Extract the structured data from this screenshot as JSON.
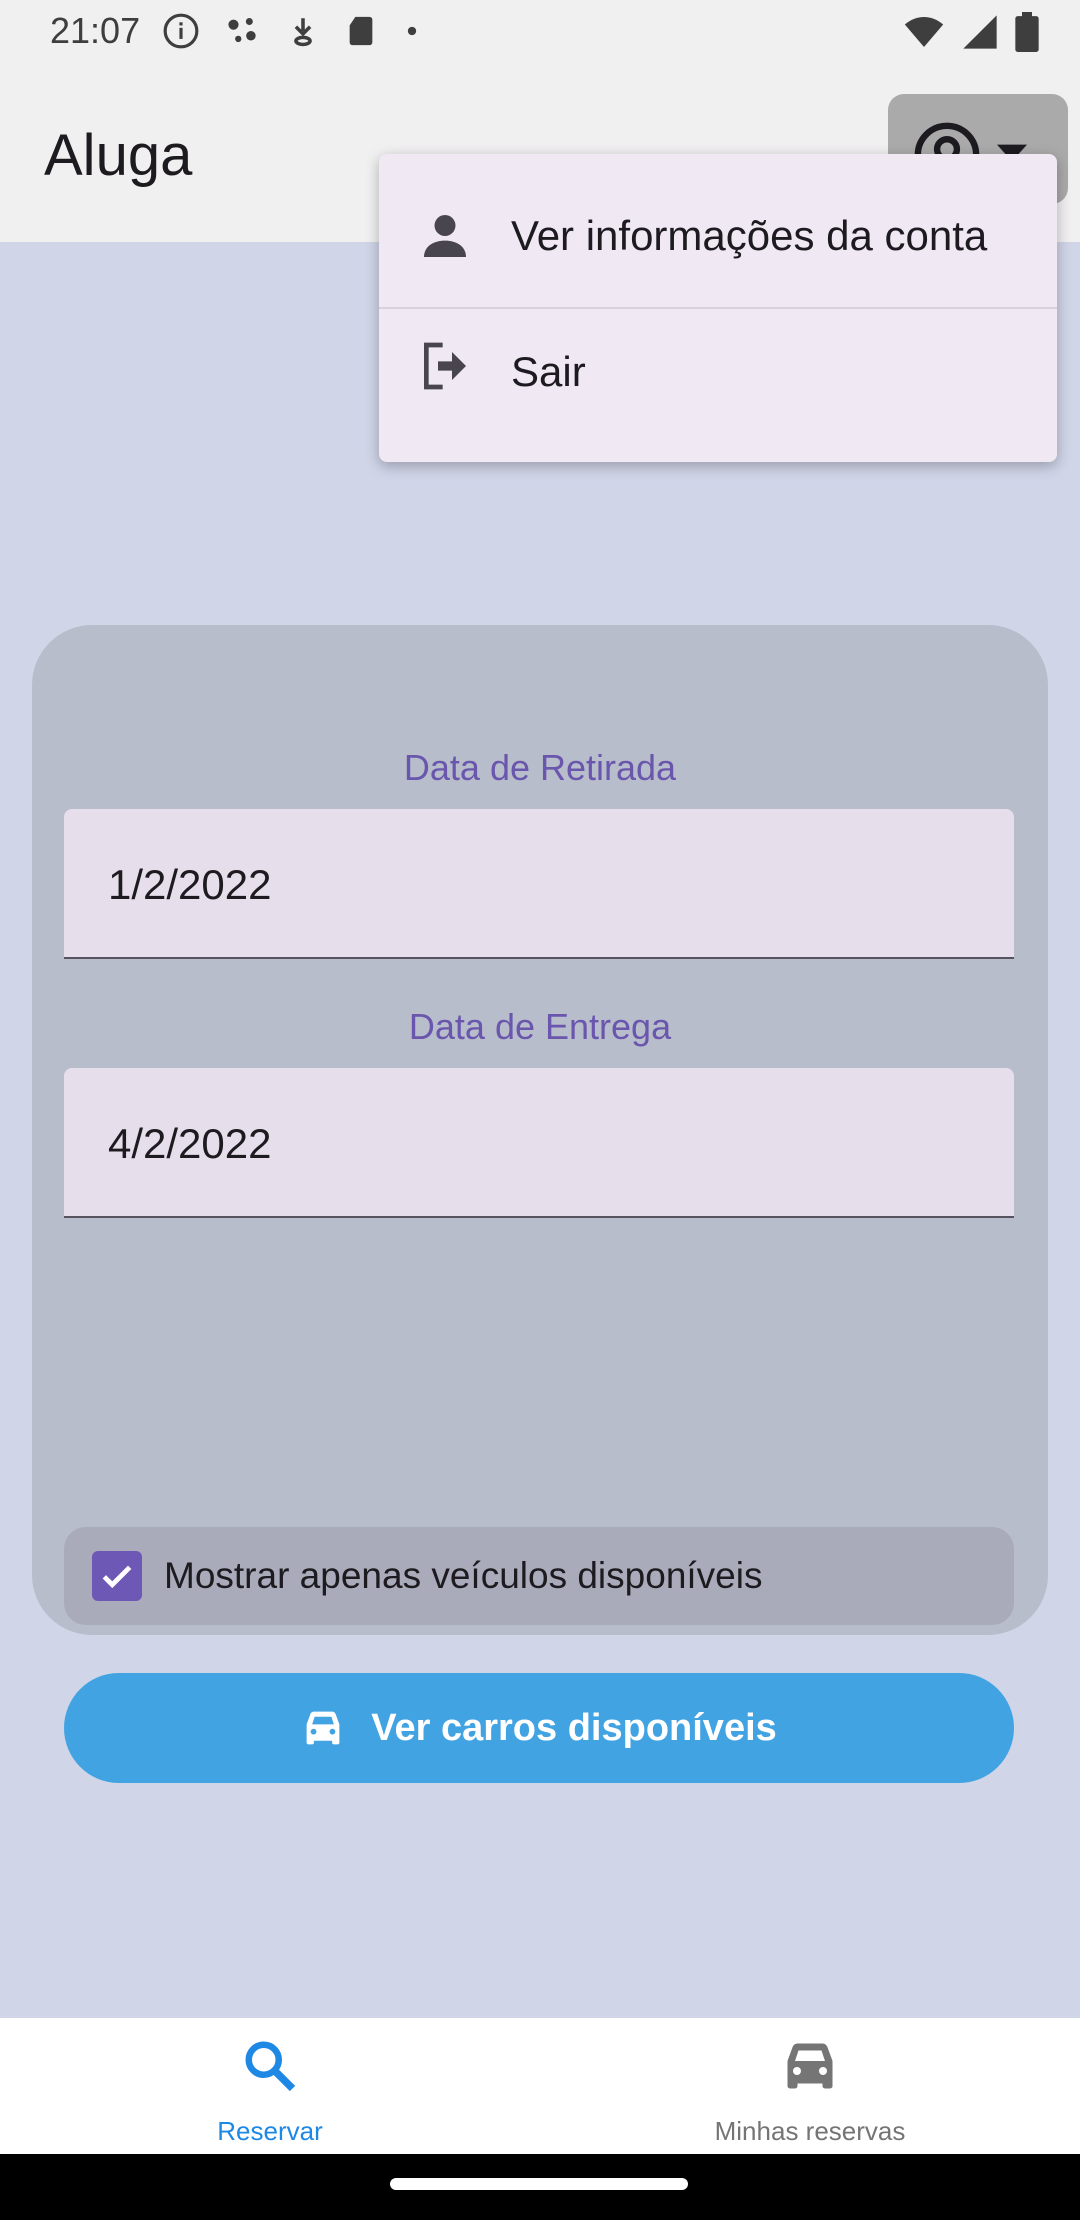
{
  "status_bar": {
    "time": "21:07",
    "left_icons": [
      "info-icon",
      "assistant-dots-icon",
      "download-icon",
      "sd-card-icon",
      "dot-icon"
    ],
    "right_icons": [
      "wifi-icon",
      "signal-icon",
      "battery-icon"
    ]
  },
  "app_bar": {
    "title": "Aluga",
    "account_icon": "account-circle-icon",
    "dropdown_icon": "chevron-down-icon"
  },
  "account_menu": {
    "items": [
      {
        "label": "Ver informações da conta",
        "icon": "person-icon"
      },
      {
        "label": "Sair",
        "icon": "logout-icon"
      }
    ]
  },
  "form": {
    "pickup_label": "Data de Retirada",
    "pickup_value": "1/2/2022",
    "return_label": "Data de Entrega",
    "return_value": "4/2/2022",
    "available_only_label": "Mostrar apenas veículos disponíveis",
    "available_only_checked": true,
    "submit_label": "Ver carros disponíveis",
    "submit_icon": "car-icon"
  },
  "bottom_nav": {
    "items": [
      {
        "label": "Reservar",
        "icon": "search-icon",
        "active": true
      },
      {
        "label": "Minhas reservas",
        "icon": "car-icon",
        "active": false
      }
    ]
  },
  "colors": {
    "accent": "#6a56ad",
    "button": "#42a3e3",
    "nav_active": "#1e88e5",
    "nav_inactive": "#757575",
    "background": "#d0d5e8",
    "card": "#b8bdcc"
  }
}
